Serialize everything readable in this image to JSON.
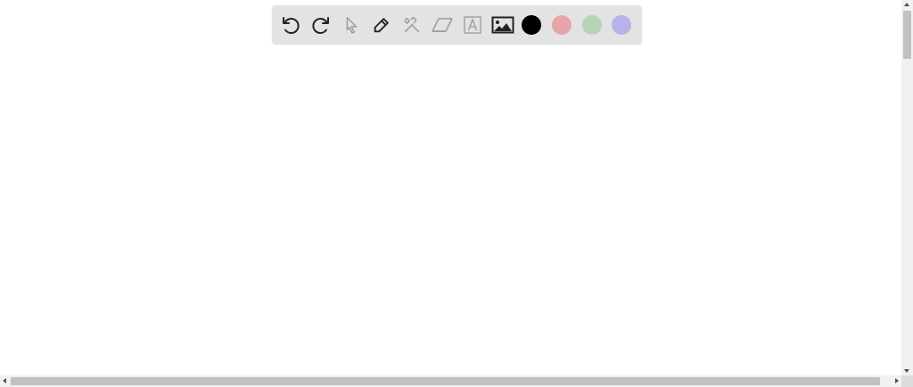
{
  "toolbar": {
    "tools": [
      {
        "name": "undo",
        "icon": "undo-icon",
        "enabled": true
      },
      {
        "name": "redo",
        "icon": "redo-icon",
        "enabled": true
      },
      {
        "name": "select",
        "icon": "cursor-arrow-icon",
        "enabled": false
      },
      {
        "name": "pen",
        "icon": "pencil-icon",
        "enabled": true
      },
      {
        "name": "tools",
        "icon": "hammer-wrench-icon",
        "enabled": false
      },
      {
        "name": "eraser",
        "icon": "eraser-icon",
        "enabled": false
      },
      {
        "name": "text",
        "icon": "text-box-icon",
        "enabled": false
      },
      {
        "name": "image",
        "icon": "image-icon",
        "enabled": true
      }
    ],
    "colors": [
      "#000000",
      "#e6a5a8",
      "#b4d6b4",
      "#b6b3ec"
    ]
  },
  "colors": {
    "toolbar_bg": "#e3e3e3",
    "icon_active": "#222222",
    "icon_disabled": "#9a9a9a"
  }
}
